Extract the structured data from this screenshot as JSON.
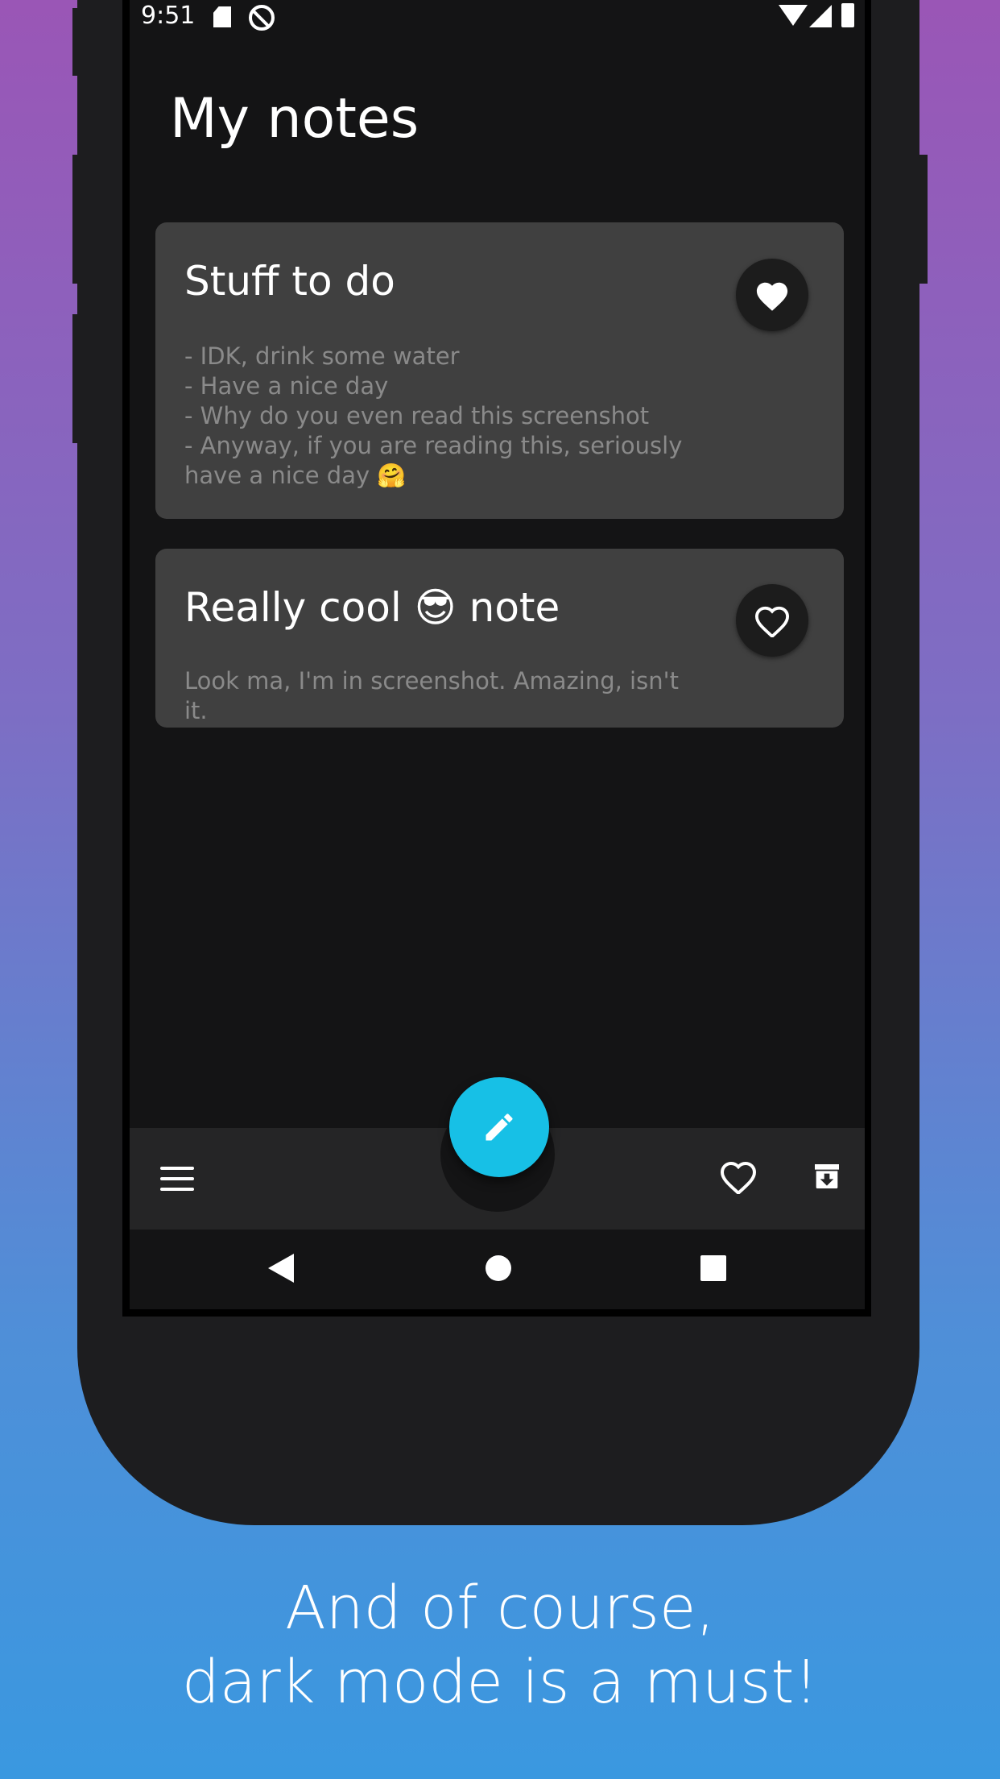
{
  "status_bar": {
    "time": "9:51"
  },
  "header": {
    "title": "My notes"
  },
  "notes": [
    {
      "title": "Stuff to do",
      "body": "- IDK, drink some water\n- Have a nice day\n- Why do you even read this screenshot\n- Anyway, if you are reading this, seriously have a nice day 🤗",
      "favorited": true
    },
    {
      "title": "Really cool 😎 note",
      "body": "Look ma, I'm in screenshot. Amazing, isn't it.",
      "favorited": false
    }
  ],
  "bottom_bar": {
    "menu_icon": "menu-icon",
    "fab_icon": "pencil-icon",
    "favorites_icon": "heart-outline-icon",
    "archive_icon": "archive-icon"
  },
  "colors": {
    "fab": "#17c0e6",
    "card_bg": "#404040",
    "screen_bg": "#141415"
  },
  "caption": {
    "line1": "And of course,",
    "line2": "dark mode is a must!"
  }
}
